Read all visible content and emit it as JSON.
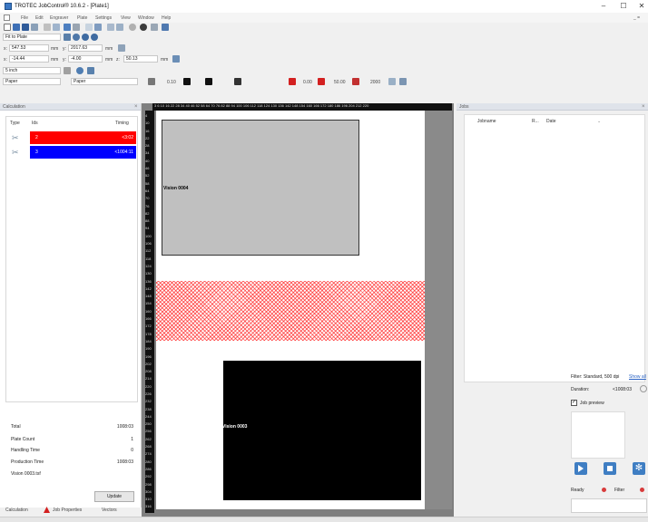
{
  "window": {
    "title": "TROTEC JobControl® 10.6.2 - [Plate1]",
    "minimize": "–",
    "maximize": "☐",
    "close": "✕",
    "mdi_controls": "_ ="
  },
  "menu": [
    "File",
    "Edit",
    "Engraver",
    "Plate",
    "Settings",
    "View",
    "Window",
    "Help"
  ],
  "toolbar": {
    "fit_label": "Fit to Plate",
    "x_label": "x:",
    "x_value": "547.53",
    "x_unit": "mm",
    "y_label": "y:",
    "y_value": "2017.63",
    "y_unit": "mm",
    "x2_label": "x:",
    "x2_value": "-14.44",
    "x2_unit": "mm",
    "y2_label": "y:",
    "y2_value": "-4.00",
    "y2_unit": "mm",
    "z_label": "z:",
    "z_value": "50.13",
    "z_unit": "mm",
    "lens_value": "5 inch",
    "material_value": "Paper",
    "material_value2": "Paper",
    "param1": "0.10",
    "param2": "0.00",
    "param3": "50.00",
    "param4": "2000"
  },
  "calculation": {
    "header": "Calculation",
    "close": "×",
    "col_type": "Type",
    "col_ids": "Ids",
    "col_timing": "Timing",
    "rows": [
      {
        "id": "2",
        "timing": "<3:02",
        "color": "#ff0000"
      },
      {
        "id": "3",
        "timing": "<1004:11",
        "color": "#0000ff"
      }
    ],
    "total_label": "Total",
    "total_value": "1008:03",
    "plate_count_label": "Plate Count",
    "plate_count_value": "1",
    "handling_label": "Handling Time",
    "handling_value": "0",
    "production_label": "Production Time",
    "production_value": "1008:03",
    "file_name": "Vision 0003.tsf",
    "update_label": "Update"
  },
  "tabs": [
    "Calculation",
    "Job Properties",
    "Vectors"
  ],
  "ruler": {
    "top": "3 6 10 16 22 28 34 40 46 52 58 64 70 76 82 88 94 100 106 112 118 124 130 136 142 148 154 160 166 172 180 186 196 204 212 220",
    "left": [
      "4",
      "10",
      "16",
      "22",
      "28",
      "34",
      "40",
      "46",
      "52",
      "58",
      "64",
      "70",
      "76",
      "82",
      "88",
      "94",
      "100",
      "106",
      "112",
      "118",
      "124",
      "130",
      "136",
      "142",
      "148",
      "154",
      "160",
      "166",
      "172",
      "178",
      "184",
      "190",
      "196",
      "202",
      "208",
      "214",
      "220",
      "226",
      "232",
      "238",
      "244",
      "250",
      "256",
      "262",
      "268",
      "274",
      "280",
      "286",
      "292",
      "298",
      "304",
      "310",
      "316"
    ]
  },
  "canvas": {
    "job1_label": "Vision 0004",
    "job2_label": "Vision 0003"
  },
  "jobs": {
    "header": "Jobs",
    "close": "×",
    "col_jobname": "Jobname",
    "col_r": "R...",
    "col_date": "Date",
    "filter_text": "Filter: Standard, 500 dpi",
    "show_all": "Show all",
    "duration_label": "Duration:",
    "duration_value": "<1008:03",
    "job_preview_label": "Job preview",
    "job_preview_checked": true,
    "ready_label": "Ready",
    "filter_label": "Filter"
  },
  "colors": {
    "red": "#ff0000",
    "blue": "#0000ff",
    "action_blue": "#3f7ec3",
    "status_red": "#d83b3b"
  }
}
